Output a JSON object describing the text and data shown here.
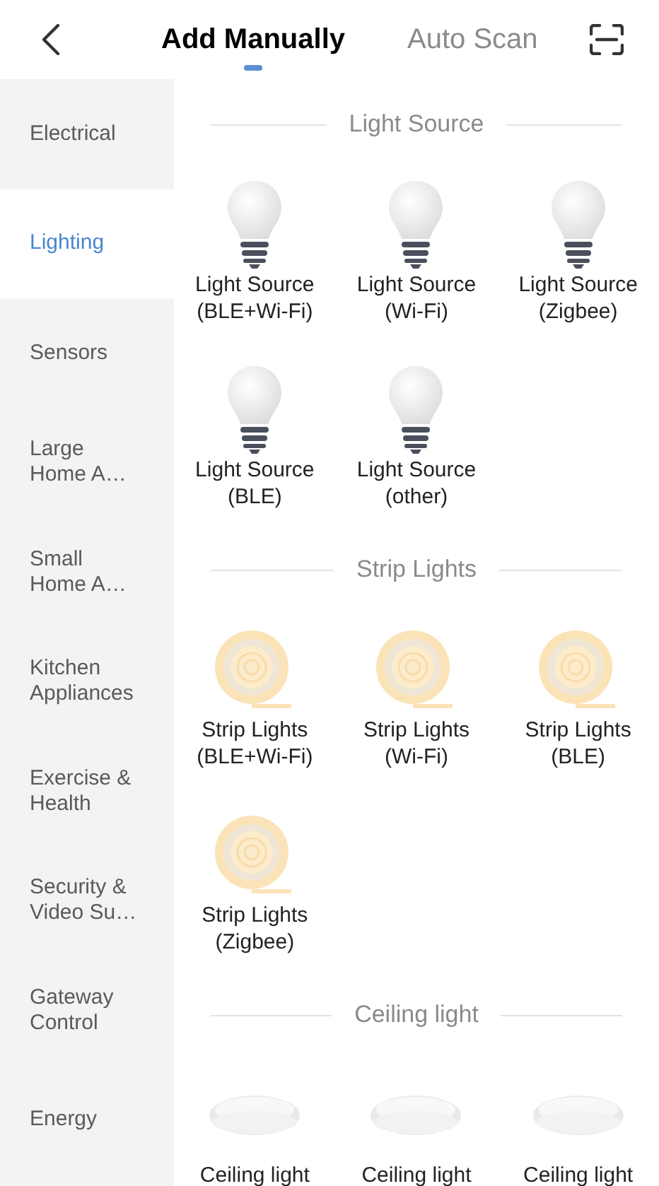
{
  "tabs": [
    {
      "label": "Add Manually",
      "selected": true
    },
    {
      "label": "Auto Scan",
      "selected": false
    }
  ],
  "sidebar": {
    "items": [
      {
        "label": "Electrical",
        "selected": false
      },
      {
        "label": "Lighting",
        "selected": true
      },
      {
        "label": "Sensors",
        "selected": false
      },
      {
        "label": "Large Home A…",
        "selected": false
      },
      {
        "label": "Small Home A…",
        "selected": false
      },
      {
        "label": "Kitchen Appliances",
        "selected": false
      },
      {
        "label": "Exercise & Health",
        "selected": false
      },
      {
        "label": "Security & Video Su…",
        "selected": false
      },
      {
        "label": "Gateway Control",
        "selected": false
      },
      {
        "label": "Energy",
        "selected": false
      }
    ]
  },
  "sections": [
    {
      "title": "Light Source",
      "devices": [
        {
          "kind": "bulb",
          "name": "Light Source",
          "variant": "(BLE+Wi-Fi)"
        },
        {
          "kind": "bulb",
          "name": "Light Source",
          "variant": "(Wi-Fi)"
        },
        {
          "kind": "bulb",
          "name": "Light Source",
          "variant": "(Zigbee)"
        },
        {
          "kind": "bulb",
          "name": "Light Source",
          "variant": "(BLE)"
        },
        {
          "kind": "bulb",
          "name": "Light Source",
          "variant": "(other)"
        }
      ]
    },
    {
      "title": "Strip Lights",
      "devices": [
        {
          "kind": "strip",
          "name": "Strip Lights",
          "variant": "(BLE+Wi-Fi)"
        },
        {
          "kind": "strip",
          "name": "Strip Lights",
          "variant": "(Wi-Fi)"
        },
        {
          "kind": "strip",
          "name": "Strip Lights",
          "variant": "(BLE)"
        },
        {
          "kind": "strip",
          "name": "Strip Lights",
          "variant": "(Zigbee)"
        }
      ]
    },
    {
      "title": "Ceiling light",
      "devices": [
        {
          "kind": "ceiling",
          "name": "Ceiling light"
        },
        {
          "kind": "ceiling",
          "name": "Ceiling light"
        },
        {
          "kind": "ceiling",
          "name": "Ceiling light"
        }
      ]
    }
  ]
}
